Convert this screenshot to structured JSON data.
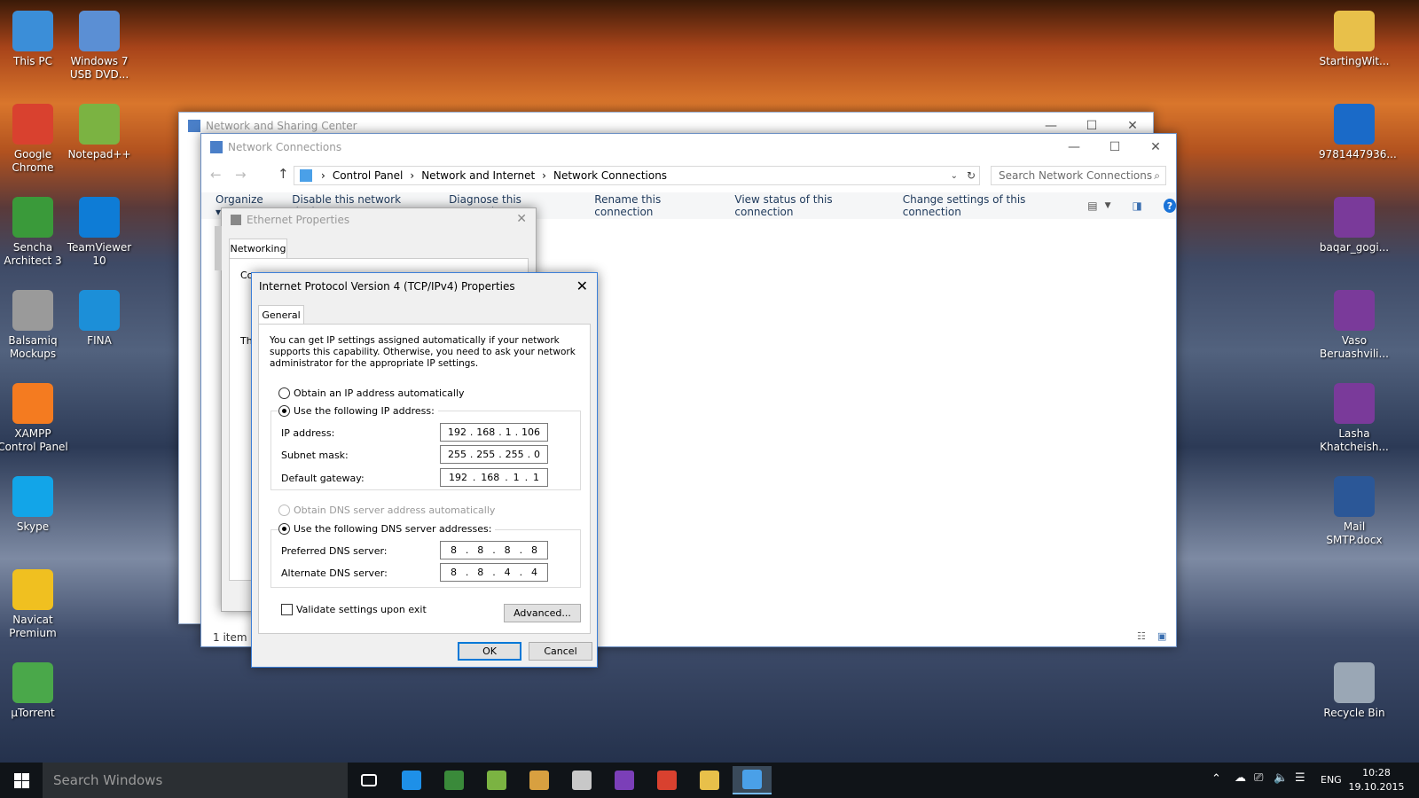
{
  "desktop_icons_left": [
    {
      "label": "This PC",
      "icon": "this-pc-icon",
      "color": "#3b8ed8"
    },
    {
      "label": "Windows 7 USB DVD...",
      "icon": "usb-dvd-tool-icon",
      "color": "#5b8fd4"
    },
    {
      "label": "Google Chrome",
      "icon": "chrome-icon",
      "color": "#d9412f"
    },
    {
      "label": "Notepad++",
      "icon": "notepad-plus-plus-icon",
      "color": "#7bb342"
    },
    {
      "label": "Sencha Architect 3",
      "icon": "sencha-icon",
      "color": "#3a9a3a"
    },
    {
      "label": "TeamViewer 10",
      "icon": "teamviewer-icon",
      "color": "#0e7cd6"
    },
    {
      "label": "Balsamiq Mockups",
      "icon": "balsamiq-icon",
      "color": "#9a9a9a"
    },
    {
      "label": "FINA",
      "icon": "fina-icon",
      "color": "#1c8fd8"
    },
    {
      "label": "XAMPP Control Panel",
      "icon": "xampp-icon",
      "color": "#f47b20"
    },
    {
      "label": "Skype",
      "icon": "skype-icon",
      "color": "#12a5e8"
    },
    {
      "label": "Navicat Premium",
      "icon": "navicat-icon",
      "color": "#f0c020"
    },
    {
      "label": "µTorrent",
      "icon": "utorrent-icon",
      "color": "#4aa84a"
    }
  ],
  "desktop_icons_right": [
    {
      "label": "StartingWit...",
      "icon": "folder-icon",
      "color": "#e8c04a"
    },
    {
      "label": "9781447936...",
      "icon": "pdf-icon",
      "color": "#1a6ac8"
    },
    {
      "label": "baqar_gogi...",
      "icon": "winrar-icon",
      "color": "#7a3a9a"
    },
    {
      "label": "Vaso Beruashvili...",
      "icon": "winrar-icon",
      "color": "#7a3a9a"
    },
    {
      "label": "Lasha Khatcheish...",
      "icon": "winrar-icon",
      "color": "#7a3a9a"
    },
    {
      "label": "Mail SMTP.docx",
      "icon": "word-doc-icon",
      "color": "#2b5797"
    },
    {
      "label": "Recycle Bin",
      "icon": "recycle-bin-icon",
      "color": "#9aa7b5"
    }
  ],
  "nsc": {
    "title": "Network and Sharing Center"
  },
  "nc": {
    "title": "Network Connections",
    "breadcrumb": [
      "Control Panel",
      "Network and Internet",
      "Network Connections"
    ],
    "search_placeholder": "Search Network Connections",
    "toolbar": [
      "Organize ▾",
      "Disable this network device",
      "Diagnose this connection",
      "Rename this connection",
      "View status of this connection",
      "Change settings of this connection"
    ],
    "status": "1 item"
  },
  "eth": {
    "title": "Ethernet Properties",
    "tab": "Networking",
    "partial": [
      "Co",
      "Th"
    ]
  },
  "ipv4": {
    "title": "Internet Protocol Version 4 (TCP/IPv4) Properties",
    "tab": "General",
    "description": "You can get IP settings assigned automatically if your network supports this capability. Otherwise, you need to ask your network administrator for the appropriate IP settings.",
    "obtain_ip": "Obtain an IP address automatically",
    "use_ip": "Use the following IP address:",
    "ip_label": "IP address:",
    "ip": [
      "192",
      "168",
      "1",
      "106"
    ],
    "mask_label": "Subnet mask:",
    "mask": [
      "255",
      "255",
      "255",
      "0"
    ],
    "gw_label": "Default gateway:",
    "gw": [
      "192",
      "168",
      "1",
      "1"
    ],
    "obtain_dns": "Obtain DNS server address automatically",
    "use_dns": "Use the following DNS server addresses:",
    "pdns_label": "Preferred DNS server:",
    "pdns": [
      "8",
      "8",
      "8",
      "8"
    ],
    "adns_label": "Alternate DNS server:",
    "adns": [
      "8",
      "8",
      "4",
      "4"
    ],
    "validate": "Validate settings upon exit",
    "advanced": "Advanced...",
    "ok": "OK",
    "cancel": "Cancel"
  },
  "taskbar": {
    "search_placeholder": "Search Windows",
    "apps": [
      {
        "icon": "task-view-icon",
        "color": "#ffffff"
      },
      {
        "icon": "edge-icon",
        "color": "#1e90e8"
      },
      {
        "icon": "network-app-icon",
        "color": "#3a8a3a"
      },
      {
        "icon": "notepad-plus-plus-icon",
        "color": "#7bb342"
      },
      {
        "icon": "sql-tool-icon",
        "color": "#d8a040"
      },
      {
        "icon": "tools-icon",
        "color": "#c8c8c8"
      },
      {
        "icon": "visual-studio-icon",
        "color": "#7b3fb8"
      },
      {
        "icon": "chrome-icon",
        "color": "#d9412f"
      },
      {
        "icon": "file-explorer-icon",
        "color": "#e8c04a"
      },
      {
        "icon": "control-panel-icon",
        "color": "#4aa0e8"
      }
    ],
    "lang": "ENG",
    "time": "10:28",
    "date": "19.10.2015"
  }
}
